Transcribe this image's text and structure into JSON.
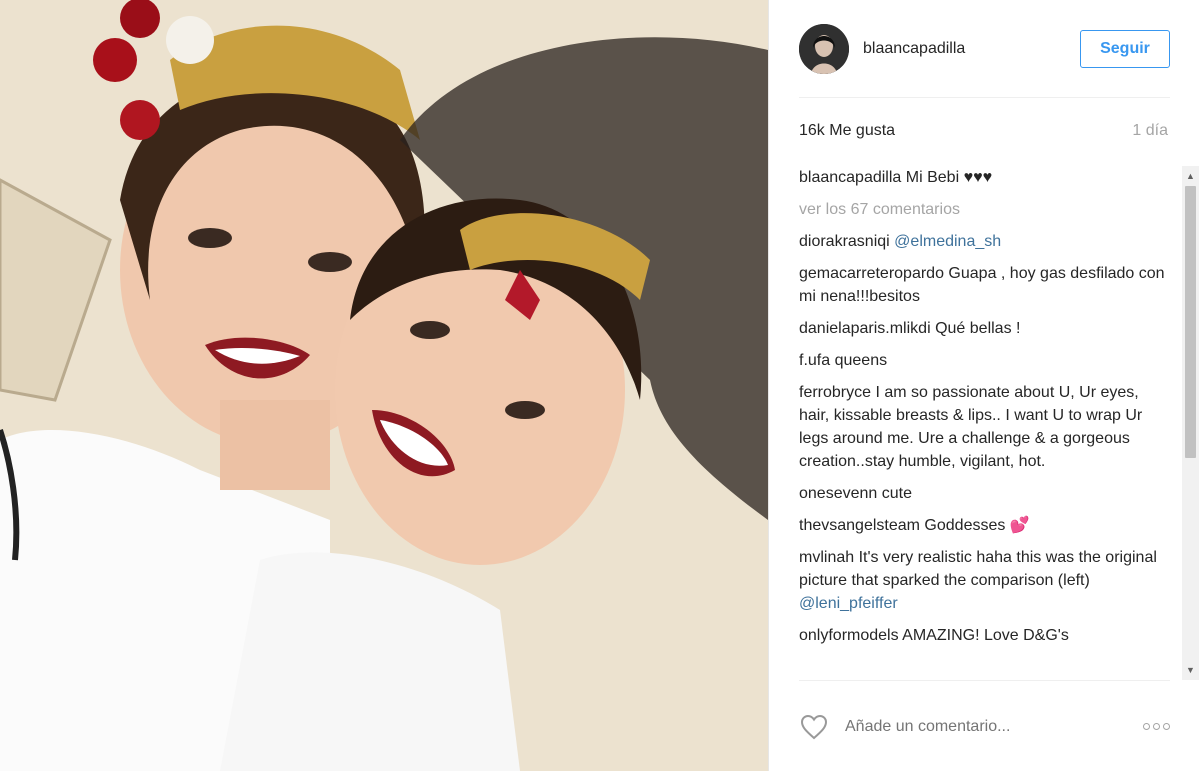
{
  "post": {
    "username": "blaancapadilla",
    "follow_label": "Seguir",
    "likes": "16k Me gusta",
    "time_ago": "1 día"
  },
  "caption": {
    "user": "blaancapadilla",
    "text": "Mi Bebi ♥♥♥"
  },
  "view_comments": "ver los 67 comentarios",
  "comments": [
    {
      "user": "diorakrasniqi",
      "text": "",
      "mention": "@elmedina_sh"
    },
    {
      "user": "gemacarreteropardo",
      "text": "Guapa , hoy gas desfilado con mi nena!!!besitos",
      "mention": ""
    },
    {
      "user": "danielaparis.mlikdi",
      "text": "Qué bellas !",
      "mention": ""
    },
    {
      "user": "f.ufa",
      "text": "queens",
      "mention": ""
    },
    {
      "user": "ferrobryce",
      "text": "I am so passionate about U, Ur eyes, hair, kissable breasts & lips.. I want U to wrap Ur legs around me. Ure a challenge & a gorgeous creation..stay humble, vigilant, hot.",
      "mention": ""
    },
    {
      "user": "onesevenn",
      "text": "cute",
      "mention": ""
    },
    {
      "user": "thevsangelsteam",
      "text": "Goddesses 💕",
      "mention": ""
    },
    {
      "user": "mvlinah",
      "text": "It's very realistic haha this was the original picture that sparked the comparison (left)",
      "mention": "@leni_pfeiffer"
    },
    {
      "user": "onlyformodels",
      "text": "AMAZING! Love D&G's",
      "mention": ""
    }
  ],
  "add_comment_placeholder": "Añade un comentario...",
  "icons": {
    "like": "heart-icon",
    "options": "more-options-icon",
    "scroll_up": "scroll-up-arrow-icon",
    "scroll_down": "scroll-down-arrow-icon"
  },
  "colors": {
    "accent": "#3897f0",
    "mention": "#3f729b",
    "muted": "#a5a5a5"
  }
}
